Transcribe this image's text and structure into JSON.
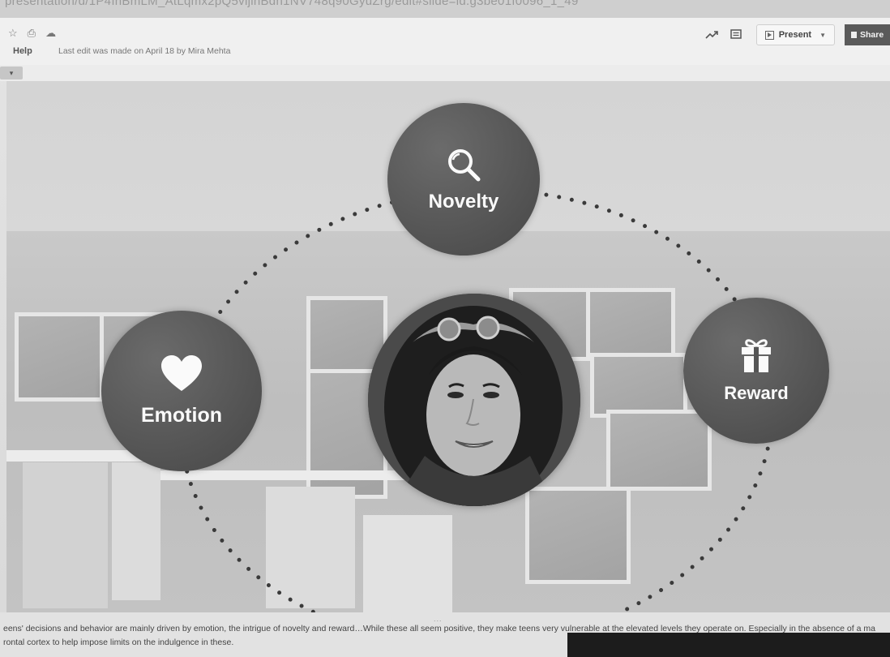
{
  "browser": {
    "url": "presentation/d/1P4InBmLM_AtLqmx2pQ5vljlnBdn1NV748q90GyuZrg/edit#slide=id.g3be01f0096_1_49"
  },
  "header": {
    "menu_help": "Help",
    "last_edit": "Last edit was made on April 18 by Mira Mehta",
    "present_label": "Present",
    "share_label": "Share"
  },
  "toolbar": {
    "chip_caret": "▾"
  },
  "slide": {
    "circles": [
      {
        "label": "Novelty",
        "icon": "magnifier-icon"
      },
      {
        "label": "Emotion",
        "icon": "heart-icon"
      },
      {
        "label": "Reward",
        "icon": "gift-icon"
      }
    ],
    "center_photo": "portrait-photo"
  },
  "notes": {
    "handle": "...",
    "text": "eens' decisions and behavior are mainly driven by emotion, the intrigue of novelty and reward…While these all seem positive, they make teens very vulnerable at the elevated levels they operate on. Especially in the absence of a ma\nrontal cortex to help impose limits on the indulgence in these."
  },
  "colors": {
    "circle": "#555555",
    "dots": "#3a3a3a"
  }
}
